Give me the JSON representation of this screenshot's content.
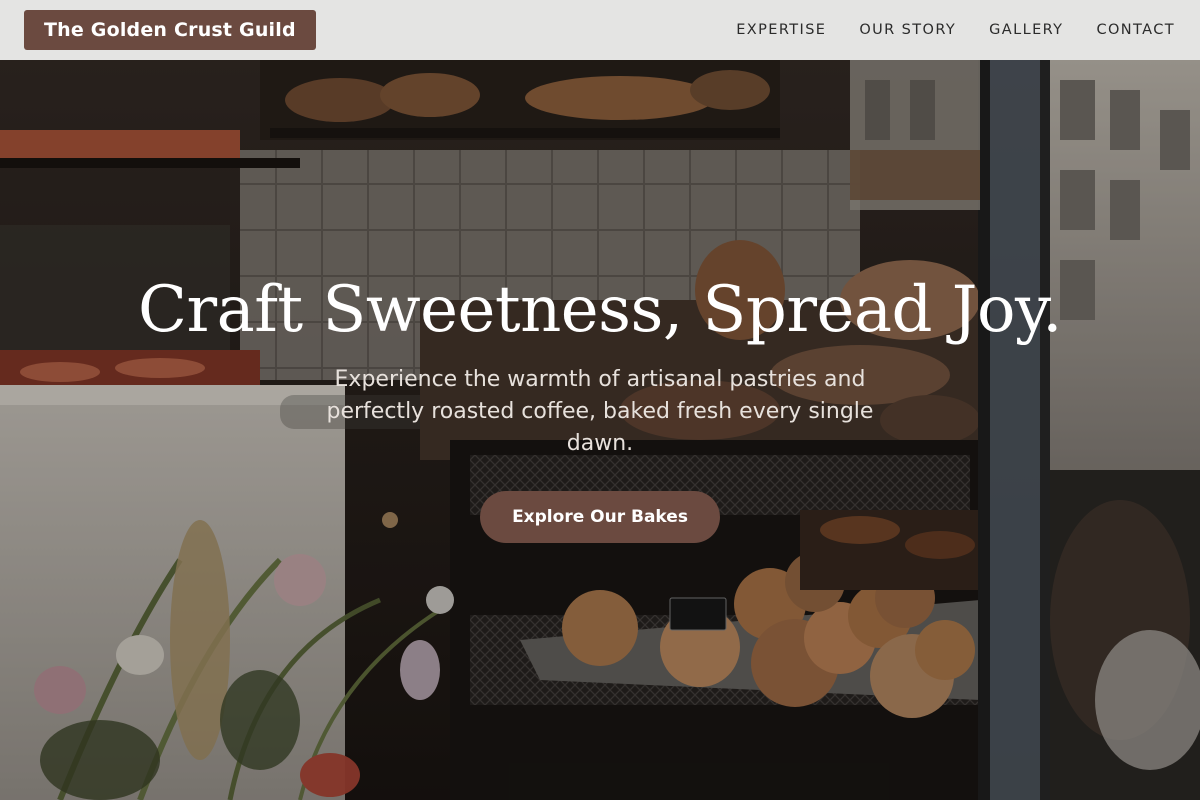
{
  "brand": {
    "name": "The Golden Crust Guild"
  },
  "nav": {
    "items": [
      {
        "label": "EXPERTISE"
      },
      {
        "label": "OUR STORY"
      },
      {
        "label": "GALLERY"
      },
      {
        "label": "CONTACT"
      }
    ]
  },
  "hero": {
    "title": "Craft Sweetness, Spread Joy.",
    "subtitle": "Experience the warmth of artisanal pastries and perfectly roasted coffee, baked fresh every single dawn.",
    "cta_label": "Explore Our Bakes"
  },
  "colors": {
    "brand_bg": "#6b4a40",
    "navbar_bg": "#f0f0f0",
    "cta_bg": "#6b4a40",
    "title_text": "#ffffff"
  }
}
